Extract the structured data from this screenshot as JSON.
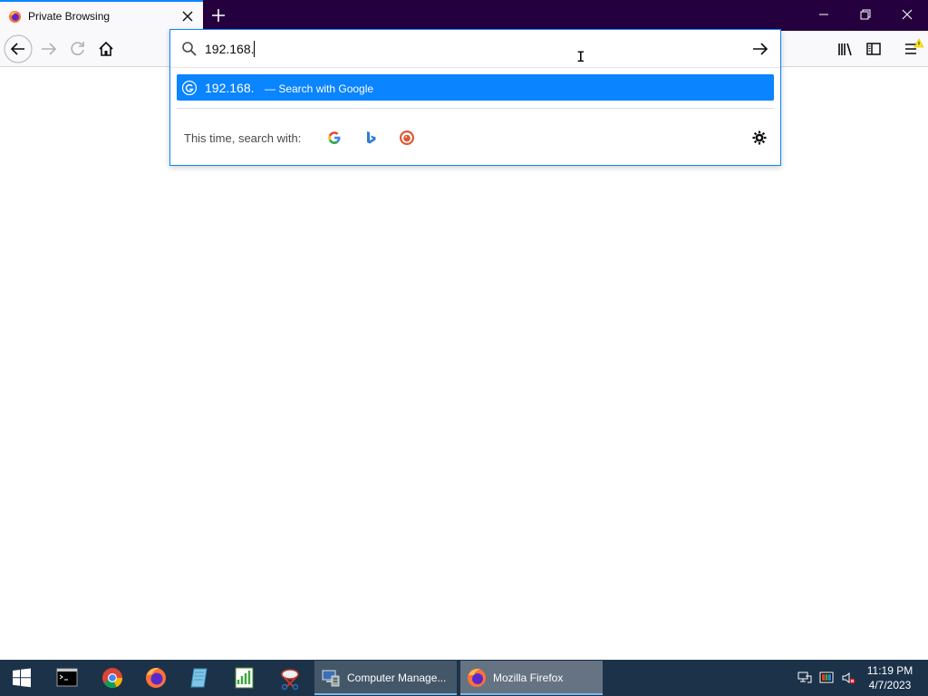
{
  "browser": {
    "tab": {
      "title": "Private Browsing"
    },
    "url_bar": {
      "value": "192.168."
    },
    "suggestion": {
      "query": "192.168.",
      "action": "— Search with Google"
    },
    "one_off": {
      "label": "This time, search with:",
      "engines": [
        "google-icon",
        "bing-icon",
        "duckduckgo-icon"
      ]
    }
  },
  "taskbar": {
    "tasks": [
      {
        "label": "Computer Manage...",
        "icon": "computer-management-icon"
      },
      {
        "label": "Mozilla Firefox",
        "icon": "firefox-icon"
      }
    ],
    "clock": {
      "time": "11:19 PM",
      "date": "4/7/2023"
    }
  },
  "colors": {
    "accent": "#0a84ff",
    "tabbar": "#25003e",
    "taskbar": "#1c3249"
  }
}
